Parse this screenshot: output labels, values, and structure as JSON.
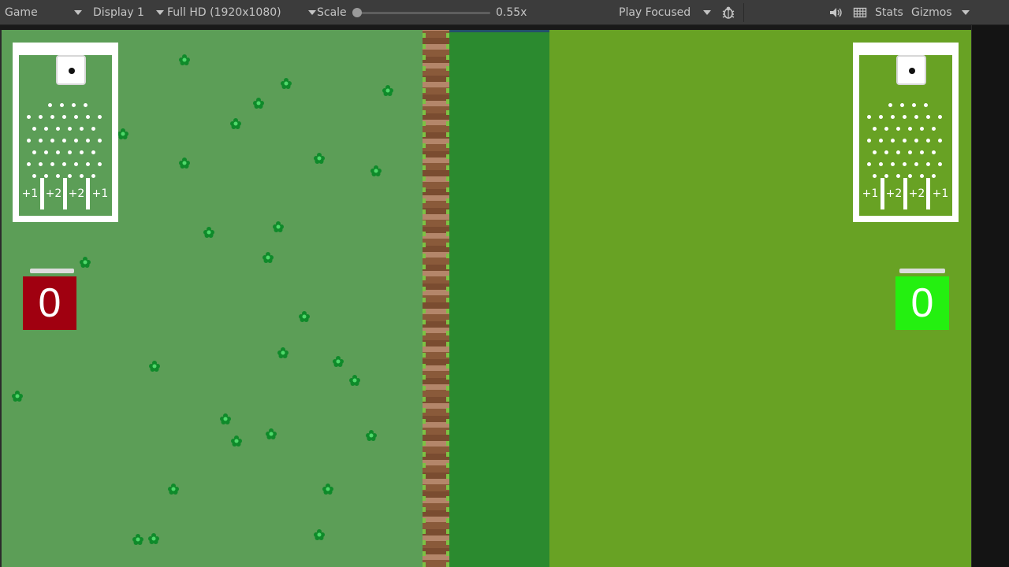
{
  "toolbar": {
    "tab_label": "Game",
    "display_label": "Display 1",
    "resolution_label": "Full HD (1920x1080)",
    "scale_label": "Scale",
    "scale_value": "0.55x",
    "play_mode_label": "Play Focused",
    "stats_label": "Stats",
    "gizmos_label": "Gizmos",
    "icons": [
      "bug-icon",
      "speaker-icon",
      "grid-icon"
    ]
  },
  "game": {
    "left_player": {
      "score": "0",
      "score_color": "#a00010",
      "board_labels": [
        "+1",
        "+2",
        "+2",
        "+1"
      ]
    },
    "right_player": {
      "score": "0",
      "score_color": "#24f010",
      "board_labels": [
        "+1",
        "+2",
        "+2",
        "+1"
      ]
    },
    "colors": {
      "left_field": "#5c9e57",
      "right_field": "#68a224",
      "water_lane": "#2b8a2f",
      "dirt_wall": "#8a5a3a"
    }
  }
}
